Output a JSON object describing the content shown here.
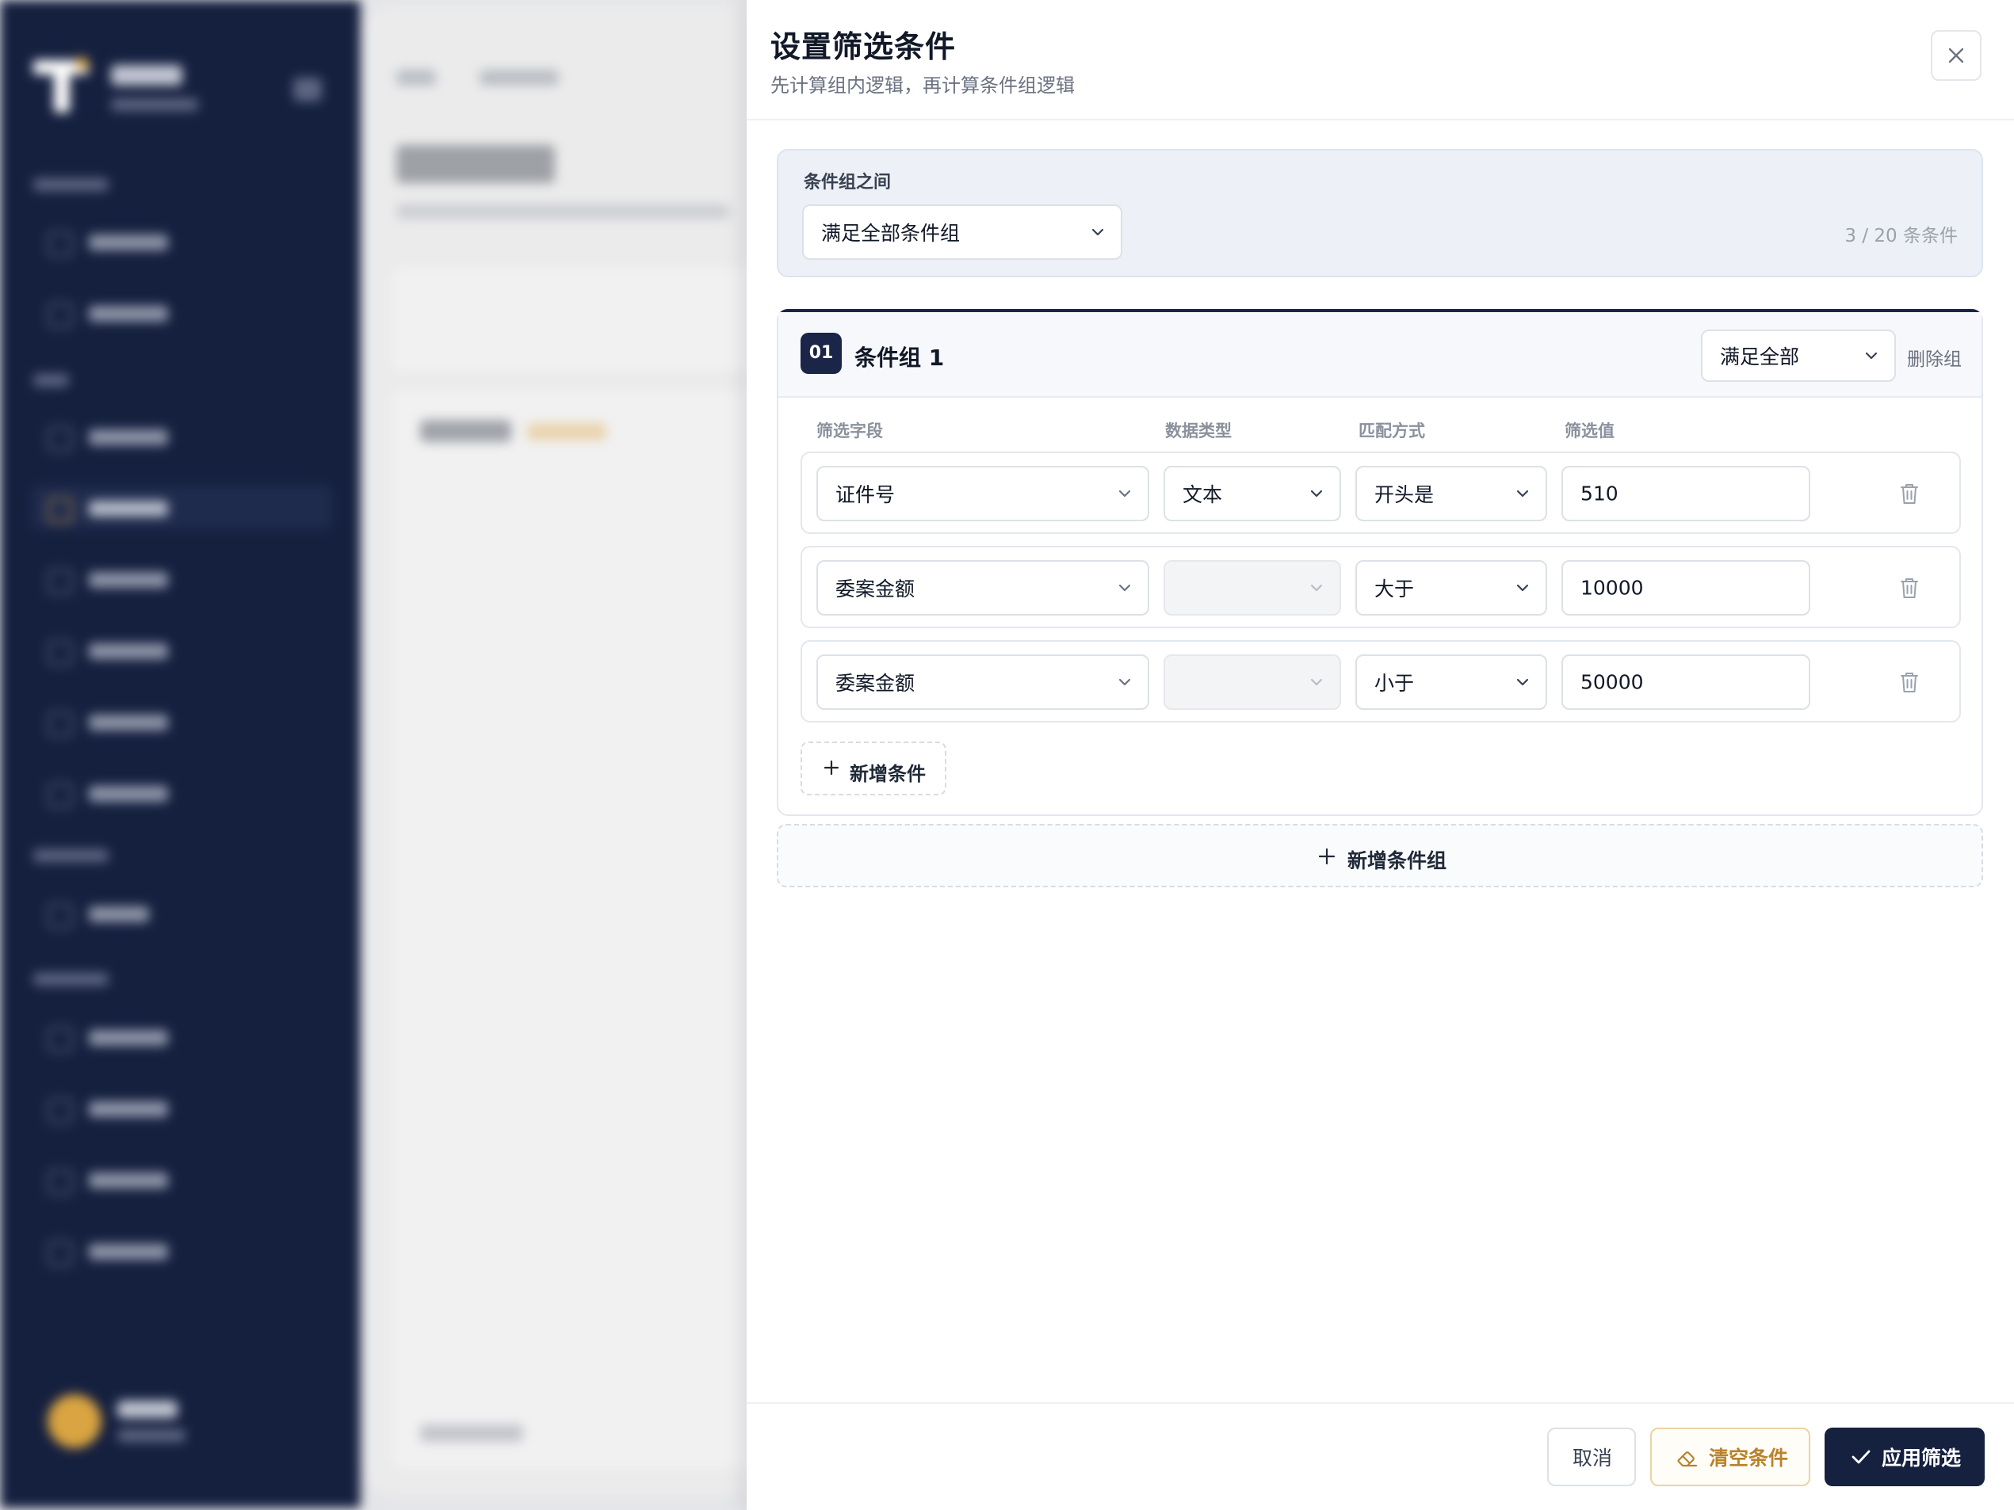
{
  "drawer": {
    "title": "设置筛选条件",
    "subtitle": "先计算组内逻辑，再计算条件组逻辑"
  },
  "group_logic": {
    "label": "条件组之间",
    "selected": "满足全部条件组",
    "count": "3 / 20 条条件"
  },
  "group": {
    "badge": "01",
    "name": "条件组 1",
    "logic_selected": "满足全部",
    "delete_label": "删除组",
    "columns": {
      "field": "筛选字段",
      "type": "数据类型",
      "match": "匹配方式",
      "value": "筛选值"
    },
    "conditions": [
      {
        "field": "证件号",
        "type": "文本",
        "match": "开头是",
        "value": "510"
      },
      {
        "field": "委案金额",
        "type": "",
        "match": "大于",
        "value": "10000"
      },
      {
        "field": "委案金额",
        "type": "",
        "match": "小于",
        "value": "50000"
      }
    ],
    "add_condition_label": "新增条件"
  },
  "add_group_label": "新增条件组",
  "footer": {
    "cancel_label": "取消",
    "clear_label": "清空条件",
    "apply_label": "应用筛选"
  },
  "icons": [
    "close-icon",
    "chevron-down-icon",
    "trash-icon",
    "plus-icon",
    "eraser-icon",
    "check-icon"
  ],
  "colors": {
    "primary": "#15213f",
    "accent": "#b9822a",
    "sidebar": "#15203f"
  }
}
